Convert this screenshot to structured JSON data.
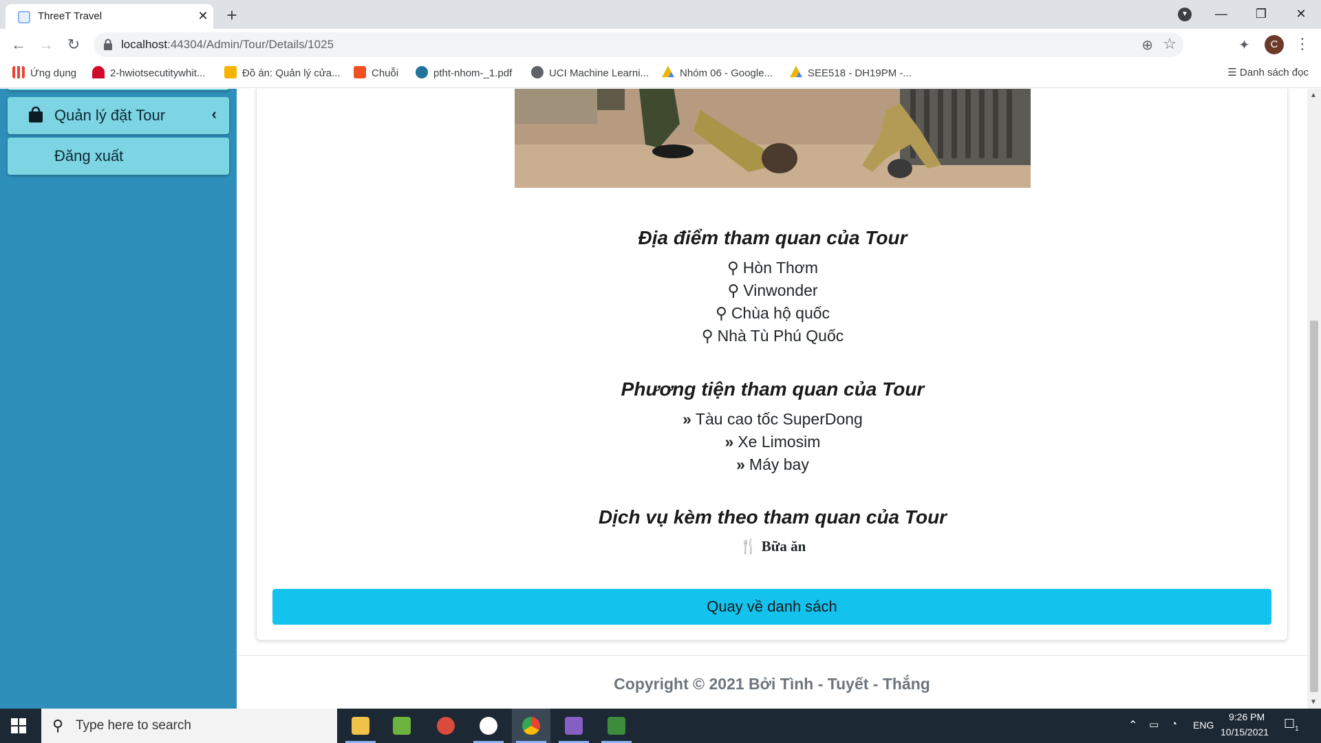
{
  "browser": {
    "tab_title": "ThreeT Travel",
    "url_host": "localhost",
    "url_rest": ":44304/Admin/Tour/Details/1025",
    "bookmarks": [
      {
        "label": "Ứng dụng",
        "icon": "apps-grid-icon",
        "color": "#ea4335"
      },
      {
        "label": "2-hwiotsecutitywhit...",
        "icon": "huawei-icon",
        "color": "#cf0a2c"
      },
      {
        "label": "Đồ án: Quản lý cửa...",
        "icon": "bookmark-icon",
        "color": "#f4b400"
      },
      {
        "label": "Chuỗi",
        "icon": "f8-icon",
        "color": "#f05123"
      },
      {
        "label": "ptht-nhom-_1.pdf",
        "icon": "wordpress-icon",
        "color": "#21759b"
      },
      {
        "label": "UCI Machine Learni...",
        "icon": "globe-icon",
        "color": "#5f6368"
      },
      {
        "label": "Nhóm 06 - Google...",
        "icon": "google-drive-icon",
        "color": "#0f9d58"
      },
      {
        "label": "SEE518 - DH19PM -...",
        "icon": "google-drive-icon",
        "color": "#0f9d58"
      }
    ],
    "reading_list": "Danh sách đọc",
    "avatar_letter": "C"
  },
  "sidebar": {
    "items": [
      {
        "label": "Quản lý đặt Tour"
      },
      {
        "label": "Đăng xuất"
      }
    ]
  },
  "tour": {
    "places_title": "Địa điểm tham quan của Tour",
    "places": [
      "Hòn Thơm",
      "Vinwonder",
      "Chùa hộ quốc",
      "Nhà Tù Phú Quốc"
    ],
    "transport_title": "Phương tiện tham quan của Tour",
    "transports": [
      "Tàu cao tốc SuperDong",
      "Xe Limosim",
      "Máy bay"
    ],
    "services_title": "Dịch vụ kèm theo tham quan của Tour",
    "services": [
      "Bữa ăn"
    ],
    "back_label": "Quay về danh sách"
  },
  "footer": {
    "copyright": "Copyright © 2021 Bởi Tình - Tuyết - Thắng"
  },
  "taskbar": {
    "search_placeholder": "Type here to search",
    "language": "ENG",
    "time": "9:26 PM",
    "date": "10/15/2021",
    "notification_count": "1"
  },
  "colors": {
    "sidebar_bg": "#2e8fba",
    "sidebar_button": "#7dd4e2",
    "primary_button": "#14c2ee"
  }
}
